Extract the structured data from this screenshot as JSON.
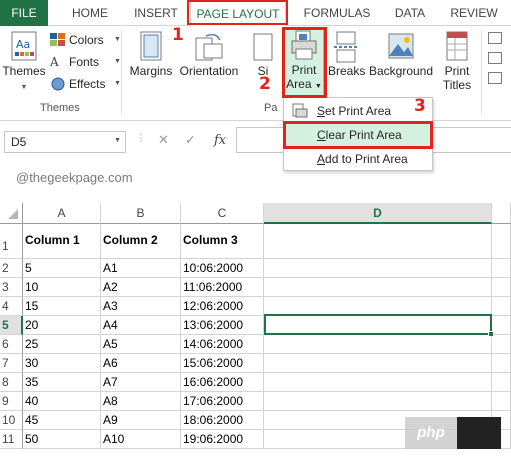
{
  "tabs": {
    "file": "FILE",
    "home": "HOME",
    "insert": "INSERT",
    "page_layout": "PAGE LAYOUT",
    "formulas": "FORMULAS",
    "data": "DATA",
    "review": "REVIEW"
  },
  "ribbon": {
    "themes": "Themes",
    "colors": "Colors",
    "fonts": "Fonts",
    "effects": "Effects",
    "themes_group": "Themes",
    "margins": "Margins",
    "orientation": "Orientation",
    "size": "Si",
    "print_area_line1": "Print",
    "print_area_line2": "Area",
    "breaks": "Breaks",
    "background": "Background",
    "print_titles_line1": "Print",
    "print_titles_line2": "Titles",
    "page_setup_group_fragment": "Pa"
  },
  "dropdown": {
    "set_print_area_u": "S",
    "set_print_area_rest": "et Print Area",
    "clear_print_area_u": "C",
    "clear_print_area_rest": "lear Print Area",
    "add_to_print_area_u": "A",
    "add_to_print_area_rest": "dd to Print Area"
  },
  "formula_bar": {
    "name_box": "D5",
    "fx": "fx"
  },
  "watermark": "@thegeekpage.com",
  "sheet": {
    "columns": [
      "A",
      "B",
      "C",
      "D"
    ],
    "selected_column": "D",
    "selected_row": "5",
    "rows": [
      {
        "n": "1",
        "a": "Column 1",
        "b": "Column 2",
        "c": "Column 3"
      },
      {
        "n": "2",
        "a": "5",
        "b": "A1",
        "c": "10:06:2000"
      },
      {
        "n": "3",
        "a": "10",
        "b": "A2",
        "c": "11:06:2000"
      },
      {
        "n": "4",
        "a": "15",
        "b": "A3",
        "c": "12:06:2000"
      },
      {
        "n": "5",
        "a": "20",
        "b": "A4",
        "c": "13:06:2000"
      },
      {
        "n": "6",
        "a": "25",
        "b": "A5",
        "c": "14:06:2000"
      },
      {
        "n": "7",
        "a": "30",
        "b": "A6",
        "c": "15:06:2000"
      },
      {
        "n": "8",
        "a": "35",
        "b": "A7",
        "c": "16:06:2000"
      },
      {
        "n": "9",
        "a": "40",
        "b": "A8",
        "c": "17:06:2000"
      },
      {
        "n": "10",
        "a": "45",
        "b": "A9",
        "c": "18:06:2000"
      },
      {
        "n": "11",
        "a": "50",
        "b": "A10",
        "c": "19:06:2000"
      }
    ]
  },
  "annotations": {
    "step1": "1",
    "step2": "2",
    "step3": "3",
    "color": "#e3221b"
  },
  "badge": {
    "text": "php"
  },
  "colors": {
    "accent": "#217346",
    "highlight": "#d3f0e0"
  }
}
